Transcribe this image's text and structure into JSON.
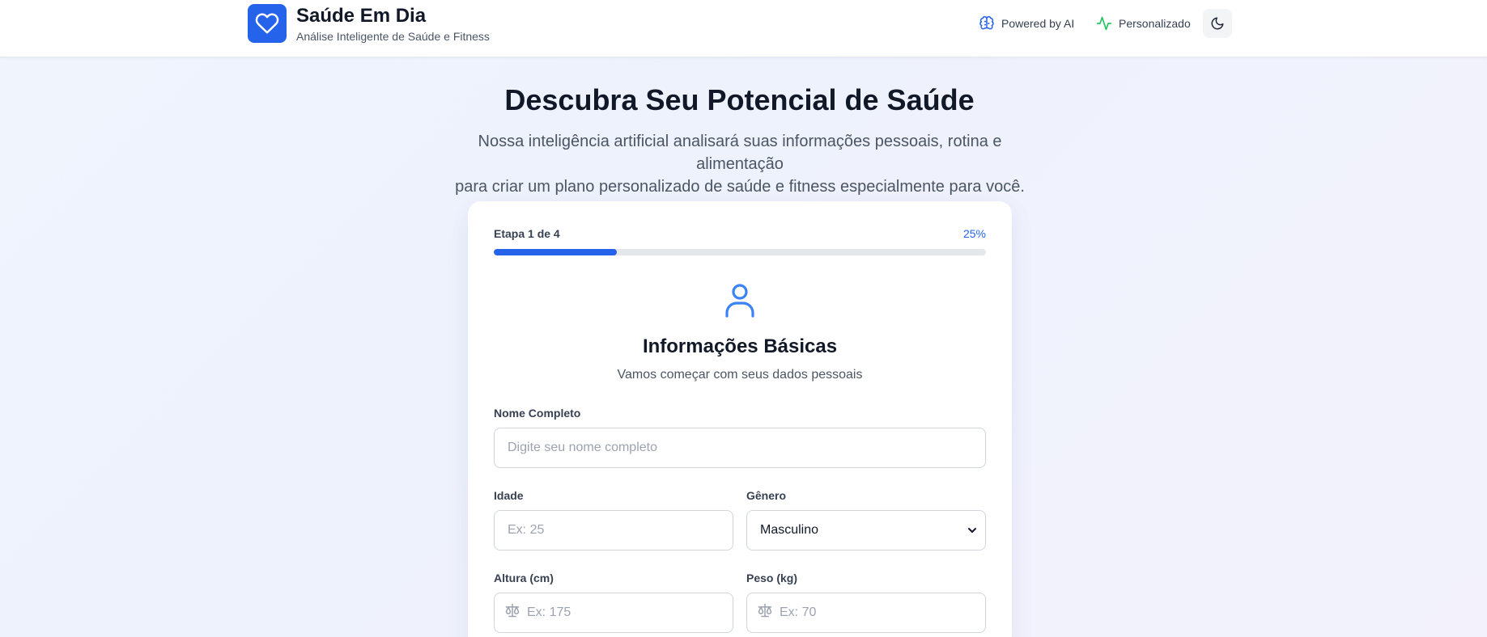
{
  "header": {
    "brand_title": "Saúde Em Dia",
    "brand_subtitle": "Análise Inteligente de Saúde e Fitness",
    "badges": [
      {
        "label": "Powered by AI",
        "icon": "brain-icon"
      },
      {
        "label": "Personalizado",
        "icon": "activity-icon"
      }
    ],
    "theme_toggle_icon": "moon-icon"
  },
  "hero": {
    "title": "Descubra Seu Potencial de Saúde",
    "text_line1": "Nossa inteligência artificial analisará suas informações pessoais, rotina e alimentação",
    "text_line2": "para criar um plano personalizado de saúde e fitness especialmente para você."
  },
  "form": {
    "step_label": "Etapa 1 de 4",
    "progress_label": "25%",
    "progress_fraction": 0.25,
    "section_icon": "user-icon",
    "section_title": "Informações Básicas",
    "section_subtitle": "Vamos começar com seus dados pessoais",
    "fields": {
      "name": {
        "label": "Nome Completo",
        "placeholder": "Digite seu nome completo",
        "value": ""
      },
      "age": {
        "label": "Idade",
        "placeholder": "Ex: 25",
        "value": ""
      },
      "gender": {
        "label": "Gênero",
        "value": "Masculino"
      },
      "height": {
        "label": "Altura (cm)",
        "placeholder": "Ex: 175",
        "value": "",
        "icon": "scale-icon"
      },
      "weight": {
        "label": "Peso (kg)",
        "placeholder": "Ex: 70",
        "value": "",
        "icon": "scale-icon"
      }
    }
  },
  "colors": {
    "accent": "#2563eb",
    "activity": "#22c55e",
    "text_primary": "#111827",
    "text_secondary": "#4b5563"
  }
}
